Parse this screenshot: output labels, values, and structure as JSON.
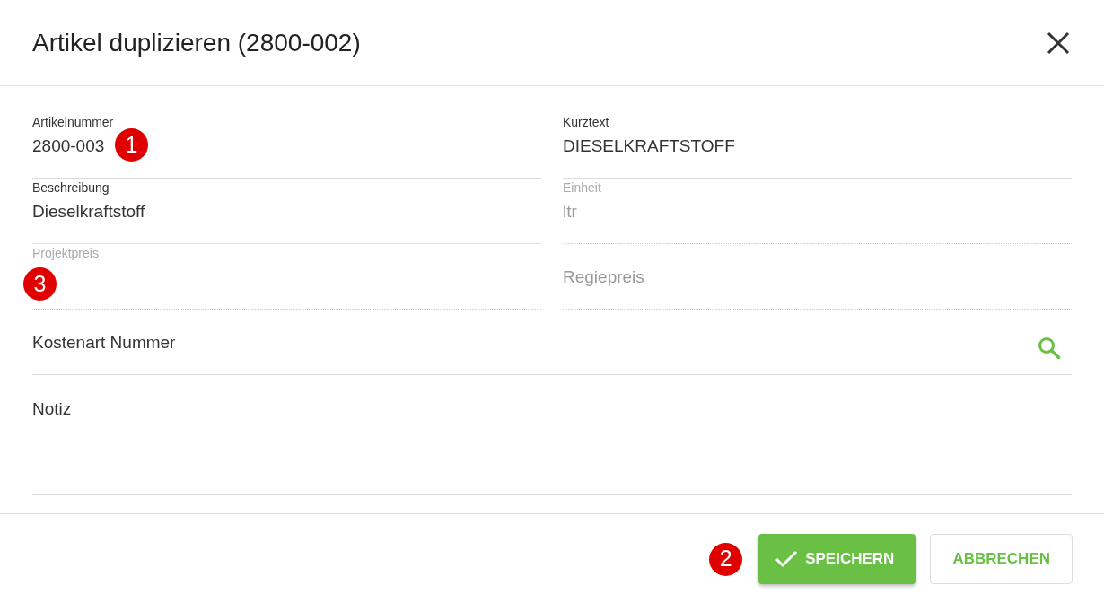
{
  "dialog": {
    "title": "Artikel duplizieren (2800-002)"
  },
  "fields": [
    {
      "kind": "text",
      "label": "Artikelnummer",
      "value": "2800-003",
      "disabled": false,
      "marker": "1"
    },
    {
      "kind": "text",
      "label": "Kurztext",
      "value": "DIESELKRAFTSTOFF",
      "disabled": false
    },
    {
      "kind": "text",
      "label": "Beschreibung",
      "value": "Dieselkraftstoff",
      "disabled": false
    },
    {
      "kind": "text",
      "label": "Einheit",
      "value": "ltr",
      "disabled": true
    },
    {
      "kind": "text",
      "label": "Projektpreis",
      "disabled": true,
      "marker": "3"
    },
    {
      "kind": "text",
      "placeholder": "Regiepreis",
      "disabled": true
    },
    {
      "kind": "search",
      "placeholder": "Kostenart Nummer",
      "disabled": false
    },
    {
      "kind": "textarea",
      "placeholder": "Notiz",
      "disabled": false
    }
  ],
  "buttons": [
    {
      "kind": "primary",
      "label": "SPEICHERN",
      "marker": "2"
    },
    {
      "kind": "outline",
      "label": "ABBRECHEN"
    }
  ]
}
